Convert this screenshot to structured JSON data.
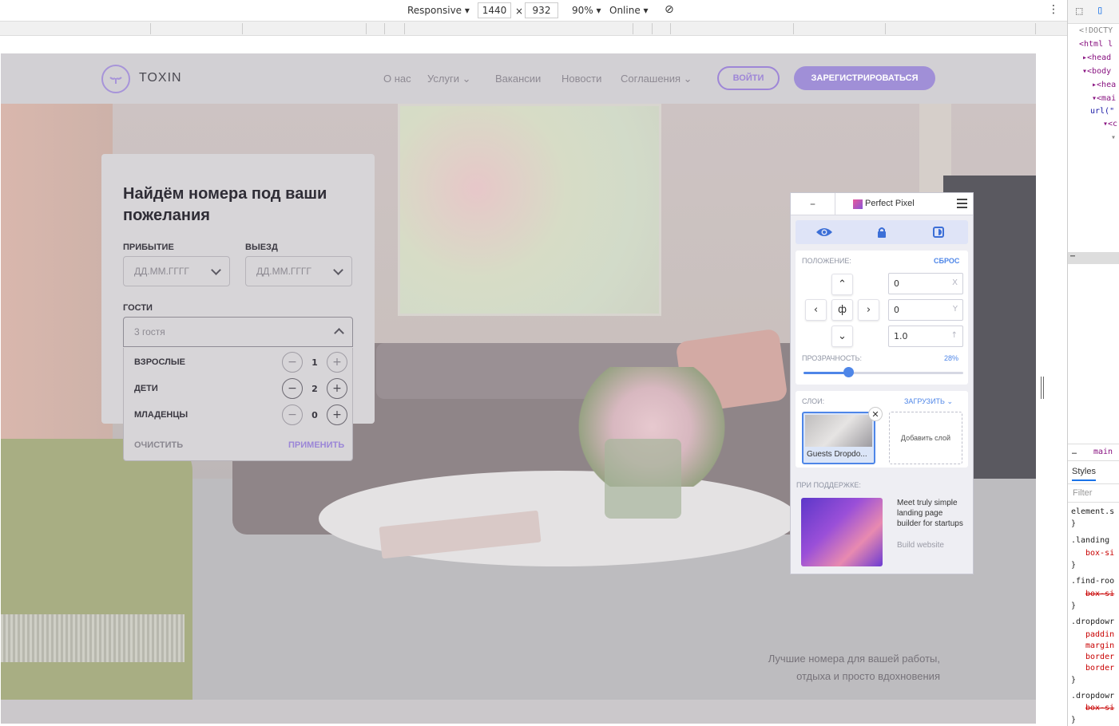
{
  "devtools": {
    "device_mode": "Responsive",
    "width": "1440",
    "height": "932",
    "zoom": "90%",
    "network": "Online",
    "code_lines": [
      "<!DOCTY",
      "<html l",
      "<head",
      "<body",
      "<hea",
      "<mai",
      "url(\"",
      "<c"
    ],
    "breadcrumb_more": "…",
    "breadcrumb_main": "main",
    "styles_tab": "Styles",
    "filter_placeholder": "Filter",
    "style_rules": [
      "element.s",
      "}",
      ".landing",
      "box-si",
      "}",
      ".find-roo",
      "box-si",
      "}",
      ".dropdowr",
      "paddin",
      "margin",
      "border",
      "border",
      "}",
      ".dropdowr",
      "box-si",
      "}"
    ]
  },
  "site": {
    "logo_text": "TOXIN",
    "nav": [
      {
        "label": "О нас",
        "has_arrow": false
      },
      {
        "label": "Услуги",
        "has_arrow": true
      },
      {
        "label": "Вакансии",
        "has_arrow": false
      },
      {
        "label": "Новости",
        "has_arrow": false
      },
      {
        "label": "Соглашения",
        "has_arrow": true
      }
    ],
    "login_label": "ВОЙТИ",
    "register_label": "ЗАРЕГИСТРИРОВАТЬСЯ",
    "tagline_line1": "Лучшие номера для вашей работы,",
    "tagline_line2": "отдыха и просто вдохновения"
  },
  "search_card": {
    "title": "Найдём номера под ваши пожелания",
    "arrival_label": "ПРИБЫТИЕ",
    "departure_label": "ВЫЕЗД",
    "date_placeholder": "ДД.ММ.ГГГГ",
    "guests_label": "ГОСТИ",
    "guests_value": "3 гостя",
    "rows": [
      {
        "label": "ВЗРОСЛЫЕ",
        "count": "1",
        "minus": "−",
        "plus": "+"
      },
      {
        "label": "ДЕТИ",
        "count": "2",
        "minus": "−",
        "plus": "+"
      },
      {
        "label": "МЛАДЕНЦЫ",
        "count": "0",
        "minus": "−",
        "plus": "+"
      }
    ],
    "clear_label": "ОЧИСТИТЬ",
    "apply_label": "ПРИМЕНИТЬ"
  },
  "perfect_pixel": {
    "title": "Perfect Pixel",
    "minimize": "–",
    "position_label": "ПОЛОЖЕНИЕ:",
    "reset_label": "СБРОС",
    "x_value": "0",
    "x_unit": "X",
    "y_value": "0",
    "y_unit": "Y",
    "scale_value": "1.0",
    "scale_unit": "↑",
    "center_symbol": "ф",
    "opacity_label": "ПРОЗРАЧНОСТЬ:",
    "opacity_value": "28%",
    "opacity_fraction": 0.28,
    "layers_label": "СЛОИ:",
    "upload_label": "ЗАГРУЗИТЬ",
    "layer_name": "Guests Dropdo...",
    "add_layer_label": "Добавить слой",
    "supported_label": "ПРИ ПОДДЕРЖКЕ:",
    "ad_text": "Meet truly simple landing page builder for startups",
    "ad_link": "Build website"
  },
  "colors": {
    "accent_purple": "#9e86d7",
    "pp_blue": "#4e86e8"
  }
}
